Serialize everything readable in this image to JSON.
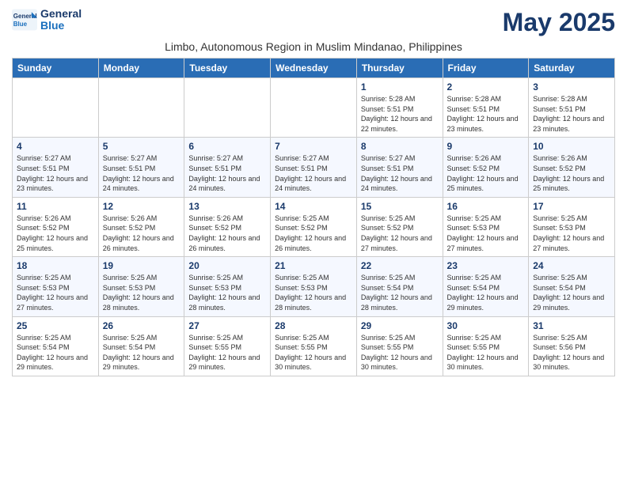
{
  "header": {
    "logo_line1": "General",
    "logo_line2": "Blue",
    "month_title": "May 2025",
    "subtitle": "Limbo, Autonomous Region in Muslim Mindanao, Philippines"
  },
  "days_of_week": [
    "Sunday",
    "Monday",
    "Tuesday",
    "Wednesday",
    "Thursday",
    "Friday",
    "Saturday"
  ],
  "weeks": [
    [
      {
        "day": "",
        "info": ""
      },
      {
        "day": "",
        "info": ""
      },
      {
        "day": "",
        "info": ""
      },
      {
        "day": "",
        "info": ""
      },
      {
        "day": "1",
        "info": "Sunrise: 5:28 AM\nSunset: 5:51 PM\nDaylight: 12 hours\nand 22 minutes."
      },
      {
        "day": "2",
        "info": "Sunrise: 5:28 AM\nSunset: 5:51 PM\nDaylight: 12 hours\nand 23 minutes."
      },
      {
        "day": "3",
        "info": "Sunrise: 5:28 AM\nSunset: 5:51 PM\nDaylight: 12 hours\nand 23 minutes."
      }
    ],
    [
      {
        "day": "4",
        "info": "Sunrise: 5:27 AM\nSunset: 5:51 PM\nDaylight: 12 hours\nand 23 minutes."
      },
      {
        "day": "5",
        "info": "Sunrise: 5:27 AM\nSunset: 5:51 PM\nDaylight: 12 hours\nand 24 minutes."
      },
      {
        "day": "6",
        "info": "Sunrise: 5:27 AM\nSunset: 5:51 PM\nDaylight: 12 hours\nand 24 minutes."
      },
      {
        "day": "7",
        "info": "Sunrise: 5:27 AM\nSunset: 5:51 PM\nDaylight: 12 hours\nand 24 minutes."
      },
      {
        "day": "8",
        "info": "Sunrise: 5:27 AM\nSunset: 5:51 PM\nDaylight: 12 hours\nand 24 minutes."
      },
      {
        "day": "9",
        "info": "Sunrise: 5:26 AM\nSunset: 5:52 PM\nDaylight: 12 hours\nand 25 minutes."
      },
      {
        "day": "10",
        "info": "Sunrise: 5:26 AM\nSunset: 5:52 PM\nDaylight: 12 hours\nand 25 minutes."
      }
    ],
    [
      {
        "day": "11",
        "info": "Sunrise: 5:26 AM\nSunset: 5:52 PM\nDaylight: 12 hours\nand 25 minutes."
      },
      {
        "day": "12",
        "info": "Sunrise: 5:26 AM\nSunset: 5:52 PM\nDaylight: 12 hours\nand 26 minutes."
      },
      {
        "day": "13",
        "info": "Sunrise: 5:26 AM\nSunset: 5:52 PM\nDaylight: 12 hours\nand 26 minutes."
      },
      {
        "day": "14",
        "info": "Sunrise: 5:25 AM\nSunset: 5:52 PM\nDaylight: 12 hours\nand 26 minutes."
      },
      {
        "day": "15",
        "info": "Sunrise: 5:25 AM\nSunset: 5:52 PM\nDaylight: 12 hours\nand 27 minutes."
      },
      {
        "day": "16",
        "info": "Sunrise: 5:25 AM\nSunset: 5:53 PM\nDaylight: 12 hours\nand 27 minutes."
      },
      {
        "day": "17",
        "info": "Sunrise: 5:25 AM\nSunset: 5:53 PM\nDaylight: 12 hours\nand 27 minutes."
      }
    ],
    [
      {
        "day": "18",
        "info": "Sunrise: 5:25 AM\nSunset: 5:53 PM\nDaylight: 12 hours\nand 27 minutes."
      },
      {
        "day": "19",
        "info": "Sunrise: 5:25 AM\nSunset: 5:53 PM\nDaylight: 12 hours\nand 28 minutes."
      },
      {
        "day": "20",
        "info": "Sunrise: 5:25 AM\nSunset: 5:53 PM\nDaylight: 12 hours\nand 28 minutes."
      },
      {
        "day": "21",
        "info": "Sunrise: 5:25 AM\nSunset: 5:53 PM\nDaylight: 12 hours\nand 28 minutes."
      },
      {
        "day": "22",
        "info": "Sunrise: 5:25 AM\nSunset: 5:54 PM\nDaylight: 12 hours\nand 28 minutes."
      },
      {
        "day": "23",
        "info": "Sunrise: 5:25 AM\nSunset: 5:54 PM\nDaylight: 12 hours\nand 29 minutes."
      },
      {
        "day": "24",
        "info": "Sunrise: 5:25 AM\nSunset: 5:54 PM\nDaylight: 12 hours\nand 29 minutes."
      }
    ],
    [
      {
        "day": "25",
        "info": "Sunrise: 5:25 AM\nSunset: 5:54 PM\nDaylight: 12 hours\nand 29 minutes."
      },
      {
        "day": "26",
        "info": "Sunrise: 5:25 AM\nSunset: 5:54 PM\nDaylight: 12 hours\nand 29 minutes."
      },
      {
        "day": "27",
        "info": "Sunrise: 5:25 AM\nSunset: 5:55 PM\nDaylight: 12 hours\nand 29 minutes."
      },
      {
        "day": "28",
        "info": "Sunrise: 5:25 AM\nSunset: 5:55 PM\nDaylight: 12 hours\nand 30 minutes."
      },
      {
        "day": "29",
        "info": "Sunrise: 5:25 AM\nSunset: 5:55 PM\nDaylight: 12 hours\nand 30 minutes."
      },
      {
        "day": "30",
        "info": "Sunrise: 5:25 AM\nSunset: 5:55 PM\nDaylight: 12 hours\nand 30 minutes."
      },
      {
        "day": "31",
        "info": "Sunrise: 5:25 AM\nSunset: 5:56 PM\nDaylight: 12 hours\nand 30 minutes."
      }
    ]
  ]
}
